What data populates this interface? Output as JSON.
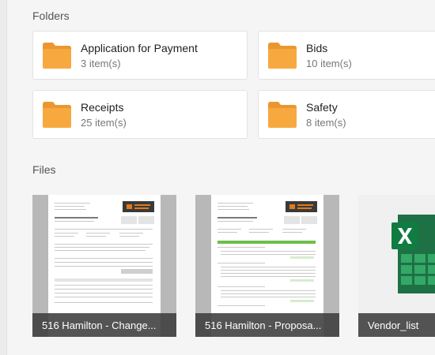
{
  "folders_section": {
    "title": "Folders",
    "items": [
      {
        "name": "Application for Payment",
        "count": "3 item(s)"
      },
      {
        "name": "Bids",
        "count": "10 item(s)"
      },
      {
        "name": "Receipts",
        "count": "25 item(s)"
      },
      {
        "name": "Safety",
        "count": "8 item(s)"
      }
    ]
  },
  "files_section": {
    "title": "Files",
    "items": [
      {
        "name": "516 Hamilton - Change...",
        "kind": "pdf-document"
      },
      {
        "name": "516 Hamilton - Proposa...",
        "kind": "pdf-document"
      },
      {
        "name": "Vendor_list",
        "kind": "excel-spreadsheet"
      }
    ]
  },
  "colors": {
    "folder": "#f7a940",
    "folder_tab": "#eb9730",
    "excel_green": "#1e7145",
    "excel_light": "#33a867",
    "caption_bg": "#3c3c3c"
  }
}
